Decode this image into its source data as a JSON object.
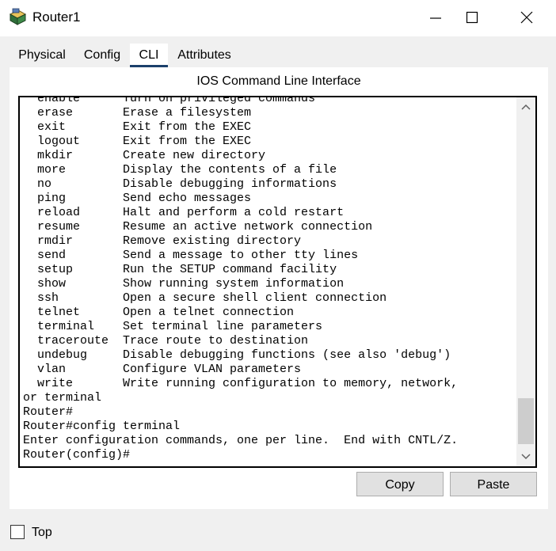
{
  "window": {
    "title": "Router1",
    "app_icon": "router-device-icon",
    "controls": [
      "minimize-icon",
      "maximize-icon",
      "close-icon"
    ]
  },
  "tabs": [
    {
      "label": "Physical",
      "selected": false
    },
    {
      "label": "Config",
      "selected": false
    },
    {
      "label": "CLI",
      "selected": true
    },
    {
      "label": "Attributes",
      "selected": false
    }
  ],
  "cli": {
    "heading": "IOS Command Line Interface",
    "terminal_output": "  enable      Turn on privileged commands\n  erase       Erase a filesystem\n  exit        Exit from the EXEC\n  logout      Exit from the EXEC\n  mkdir       Create new directory\n  more        Display the contents of a file\n  no          Disable debugging informations\n  ping        Send echo messages\n  reload      Halt and perform a cold restart\n  resume      Resume an active network connection\n  rmdir       Remove existing directory\n  send        Send a message to other tty lines\n  setup       Run the SETUP command facility\n  show        Show running system information\n  ssh         Open a secure shell client connection\n  telnet      Open a telnet connection\n  terminal    Set terminal line parameters\n  traceroute  Trace route to destination\n  undebug     Disable debugging functions (see also 'debug')\n  vlan        Configure VLAN parameters\n  write       Write running configuration to memory, network,\nor terminal\nRouter#\nRouter#config terminal\nEnter configuration commands, one per line.  End with CNTL/Z.\nRouter(config)#"
  },
  "buttons": {
    "copy": "Copy",
    "paste": "Paste"
  },
  "bottom": {
    "top_label": "Top",
    "top_checked": false
  }
}
